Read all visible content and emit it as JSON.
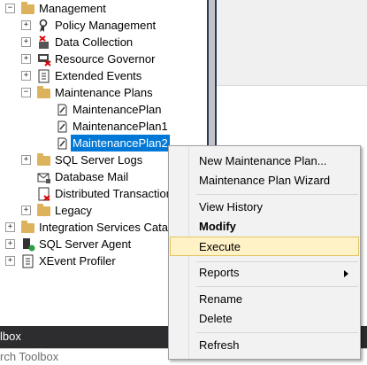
{
  "tree": {
    "management": {
      "label": "Management",
      "expander": "−"
    },
    "items": [
      {
        "label": "Policy Management",
        "expander": "+",
        "icon": "policy-icon"
      },
      {
        "label": "Data Collection",
        "expander": "+",
        "icon": "data-collection-icon"
      },
      {
        "label": "Resource Governor",
        "expander": "+",
        "icon": "resource-governor-icon"
      },
      {
        "label": "Extended Events",
        "expander": "+",
        "icon": "extended-events-icon"
      },
      {
        "label": "Maintenance Plans",
        "expander": "−",
        "icon": "folder-icon"
      }
    ],
    "plans": [
      {
        "label": "MaintenancePlan"
      },
      {
        "label": "MaintenancePlan1"
      },
      {
        "label": "MaintenancePlan2"
      }
    ],
    "after": [
      {
        "label": "SQL Server Logs",
        "expander": "+",
        "icon": "folder-icon"
      },
      {
        "label": "Database Mail",
        "expander": "",
        "icon": "database-mail-icon"
      },
      {
        "label": "Distributed Transaction",
        "expander": "",
        "icon": "distributed-transaction-icon"
      },
      {
        "label": "Legacy",
        "expander": "+",
        "icon": "folder-icon"
      }
    ],
    "root": [
      {
        "label": "Integration Services Catalo",
        "expander": "+",
        "icon": "folder-icon"
      },
      {
        "label": "SQL Server Agent",
        "expander": "+",
        "icon": "sql-agent-icon"
      },
      {
        "label": "XEvent Profiler",
        "expander": "+",
        "icon": "xevent-profiler-icon"
      }
    ]
  },
  "toolbox": {
    "title": "lbox",
    "search_placeholder": "rch Toolbox"
  },
  "context_menu": {
    "items": [
      {
        "label": "New Maintenance Plan..."
      },
      {
        "label": "Maintenance Plan Wizard"
      },
      {
        "label": "View History"
      },
      {
        "label": "Modify"
      },
      {
        "label": "Execute"
      },
      {
        "label": "Reports"
      },
      {
        "label": "Rename"
      },
      {
        "label": "Delete"
      },
      {
        "label": "Refresh"
      }
    ]
  },
  "colors": {
    "selection": "#0078d7",
    "menu_highlight": "#fff2c7",
    "toolbox_bar": "#2d2d30",
    "folder": "#dcb35c"
  }
}
